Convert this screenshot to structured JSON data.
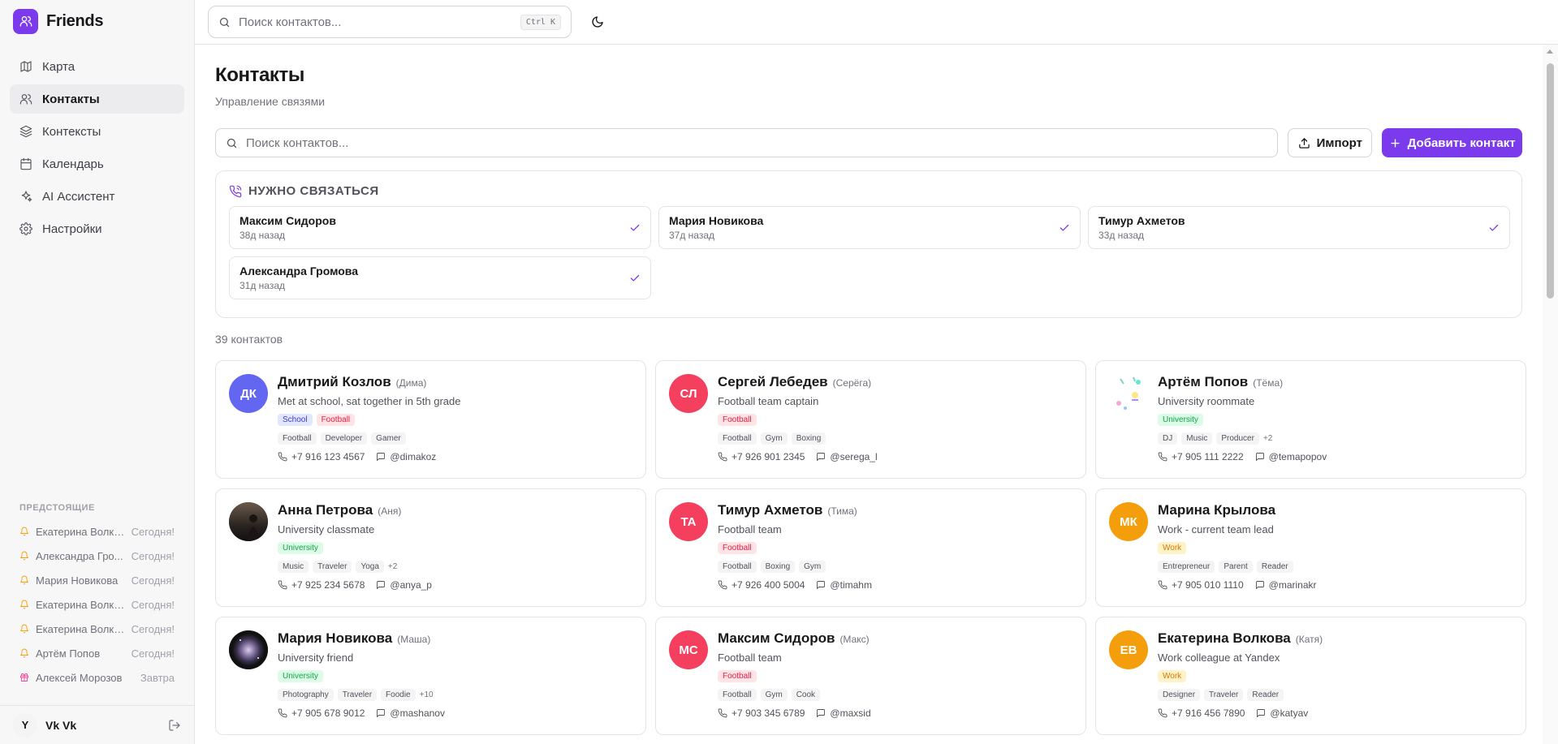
{
  "app": {
    "name": "Friends"
  },
  "top_search": {
    "placeholder": "Поиск контактов...",
    "shortcut": "Ctrl K"
  },
  "nav": [
    {
      "label": "Карта",
      "icon": "map-icon",
      "active": false
    },
    {
      "label": "Контакты",
      "icon": "users-icon",
      "active": true
    },
    {
      "label": "Контексты",
      "icon": "layers-icon",
      "active": false
    },
    {
      "label": "Календарь",
      "icon": "calendar-icon",
      "active": false
    },
    {
      "label": "AI Ассистент",
      "icon": "sparkles-icon",
      "active": false
    },
    {
      "label": "Настройки",
      "icon": "gear-icon",
      "active": false
    }
  ],
  "upcoming": {
    "title": "ПРЕДСТОЯЩИЕ",
    "items": [
      {
        "name": "Екатерина Волко...",
        "when": "Сегодня!",
        "icon": "bell-icon"
      },
      {
        "name": "Александра Гро...",
        "when": "Сегодня!",
        "icon": "bell-icon"
      },
      {
        "name": "Мария Новикова",
        "when": "Сегодня!",
        "icon": "bell-icon"
      },
      {
        "name": "Екатерина Волко...",
        "when": "Сегодня!",
        "icon": "bell-icon"
      },
      {
        "name": "Екатерина Волко...",
        "when": "Сегодня!",
        "icon": "bell-icon"
      },
      {
        "name": "Артём Попов",
        "when": "Сегодня!",
        "icon": "bell-icon"
      },
      {
        "name": "Алексей Морозов",
        "when": "Завтра",
        "icon": "gift-icon"
      }
    ]
  },
  "user": {
    "initial": "Y",
    "name": "Vk Vk"
  },
  "page": {
    "title": "Контакты",
    "subtitle": "Управление связями",
    "search_placeholder": "Поиск контактов...",
    "import_label": "Импорт",
    "add_label": "Добавить контакт",
    "count_label": "39 контактов"
  },
  "reach_out": {
    "title": "НУЖНО СВЯЗАТЬСЯ",
    "items": [
      {
        "name": "Максим Сидоров",
        "ago": "38д назад"
      },
      {
        "name": "Мария Новикова",
        "ago": "37д назад"
      },
      {
        "name": "Тимур Ахметов",
        "ago": "33д назад"
      },
      {
        "name": "Александра Громова",
        "ago": "31д назад"
      }
    ]
  },
  "colors": {
    "accent": "#7c3aed"
  },
  "contacts": [
    {
      "name": "Дмитрий Козлов",
      "nick": "(Дима)",
      "desc": "Met at school, sat together in 5th grade",
      "initials": "ДК",
      "avatar_color": "#6366f1",
      "avatar_type": "initials",
      "contexts": [
        {
          "label": "School",
          "bg": "#e0e7ff",
          "fg": "#4338ca"
        },
        {
          "label": "Football",
          "bg": "#ffe4e6",
          "fg": "#e11d48"
        }
      ],
      "tags": [
        "Football",
        "Developer",
        "Gamer"
      ],
      "more": "",
      "phone": "+7 916 123 4567",
      "handle": "@dimakoz"
    },
    {
      "name": "Сергей Лебедев",
      "nick": "(Серёга)",
      "desc": "Football team captain",
      "initials": "СЛ",
      "avatar_color": "#f43f5e",
      "avatar_type": "initials",
      "contexts": [
        {
          "label": "Football",
          "bg": "#ffe4e6",
          "fg": "#e11d48"
        }
      ],
      "tags": [
        "Football",
        "Gym",
        "Boxing"
      ],
      "more": "",
      "phone": "+7 926 901 2345",
      "handle": "@serega_l"
    },
    {
      "name": "Артём Попов",
      "nick": "(Тёма)",
      "desc": "University roommate",
      "initials": "",
      "avatar_color": "#ffffff",
      "avatar_type": "photo-doodle",
      "contexts": [
        {
          "label": "University",
          "bg": "#dcfce7",
          "fg": "#16a34a"
        }
      ],
      "tags": [
        "DJ",
        "Music",
        "Producer"
      ],
      "more": "+2",
      "phone": "+7 905 111 2222",
      "handle": "@temapopov"
    },
    {
      "name": "Анна Петрова",
      "nick": "(Аня)",
      "desc": "University classmate",
      "initials": "",
      "avatar_color": "#2b2b2b",
      "avatar_type": "photo-dark",
      "contexts": [
        {
          "label": "University",
          "bg": "#dcfce7",
          "fg": "#16a34a"
        }
      ],
      "tags": [
        "Music",
        "Traveler",
        "Yoga"
      ],
      "more": "+2",
      "phone": "+7 925 234 5678",
      "handle": "@anya_p"
    },
    {
      "name": "Тимур Ахметов",
      "nick": "(Тима)",
      "desc": "Football team",
      "initials": "ТА",
      "avatar_color": "#f43f5e",
      "avatar_type": "initials",
      "contexts": [
        {
          "label": "Football",
          "bg": "#ffe4e6",
          "fg": "#e11d48"
        }
      ],
      "tags": [
        "Football",
        "Boxing",
        "Gym"
      ],
      "more": "",
      "phone": "+7 926 400 5004",
      "handle": "@timahm"
    },
    {
      "name": "Марина Крылова",
      "nick": "",
      "desc": "Work - current team lead",
      "initials": "МК",
      "avatar_color": "#f59e0b",
      "avatar_type": "initials",
      "contexts": [
        {
          "label": "Work",
          "bg": "#fef3c7",
          "fg": "#d97706"
        }
      ],
      "tags": [
        "Entrepreneur",
        "Parent",
        "Reader"
      ],
      "more": "",
      "phone": "+7 905 010 1110",
      "handle": "@marinakr"
    },
    {
      "name": "Мария Новикова",
      "nick": "(Маша)",
      "desc": "University friend",
      "initials": "",
      "avatar_color": "#3f3f46",
      "avatar_type": "photo-galaxy",
      "contexts": [
        {
          "label": "University",
          "bg": "#dcfce7",
          "fg": "#16a34a"
        }
      ],
      "tags": [
        "Photography",
        "Traveler",
        "Foodie"
      ],
      "more": "+10",
      "phone": "+7 905 678 9012",
      "handle": "@mashanov"
    },
    {
      "name": "Максим Сидоров",
      "nick": "(Макс)",
      "desc": "Football team",
      "initials": "МС",
      "avatar_color": "#f43f5e",
      "avatar_type": "initials",
      "contexts": [
        {
          "label": "Football",
          "bg": "#ffe4e6",
          "fg": "#e11d48"
        }
      ],
      "tags": [
        "Football",
        "Gym",
        "Cook"
      ],
      "more": "",
      "phone": "+7 903 345 6789",
      "handle": "@maxsid"
    },
    {
      "name": "Екатерина Волкова",
      "nick": "(Катя)",
      "desc": "Work colleague at Yandex",
      "initials": "ЕВ",
      "avatar_color": "#f59e0b",
      "avatar_type": "initials",
      "contexts": [
        {
          "label": "Work",
          "bg": "#fef3c7",
          "fg": "#d97706"
        }
      ],
      "tags": [
        "Designer",
        "Traveler",
        "Reader"
      ],
      "more": "",
      "phone": "+7 916 456 7890",
      "handle": "@katyav"
    }
  ]
}
